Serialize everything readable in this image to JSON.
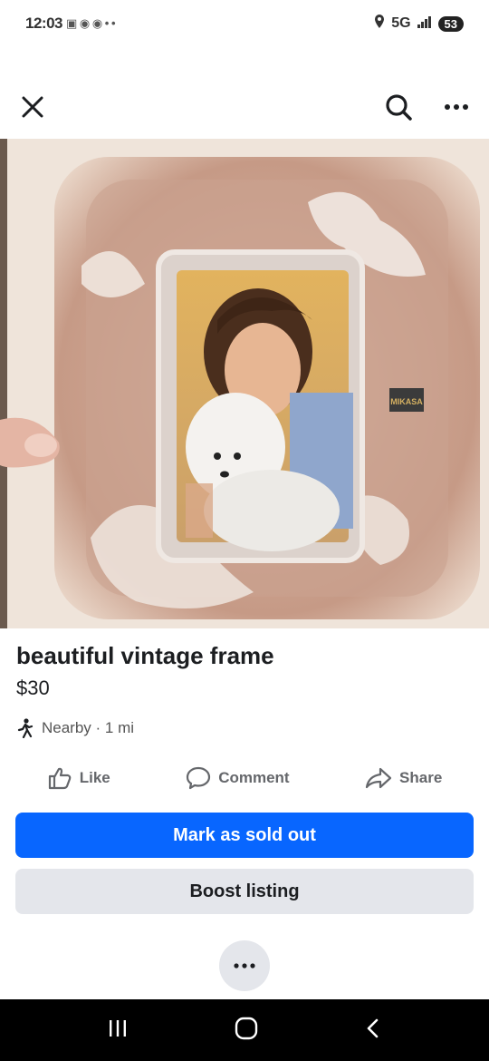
{
  "status_bar": {
    "time": "12:03",
    "network": "5G",
    "battery": "53"
  },
  "listing": {
    "title": "beautiful vintage frame",
    "price": "$30",
    "location": "Nearby · 1 mi",
    "photo_label": "MIKASA"
  },
  "actions": {
    "like": "Like",
    "comment": "Comment",
    "share": "Share"
  },
  "buttons": {
    "mark_sold": "Mark as sold out",
    "boost": "Boost listing"
  },
  "icons": {
    "close": "close-icon",
    "search": "search-icon",
    "more": "more-icon",
    "walk": "walking-person-icon",
    "like": "thumbs-up-icon",
    "comment": "comment-bubble-icon",
    "share": "share-arrow-icon"
  },
  "colors": {
    "primary": "#0866ff",
    "secondary": "#e4e6eb",
    "text": "#1c1e21",
    "muted": "#65676b"
  }
}
